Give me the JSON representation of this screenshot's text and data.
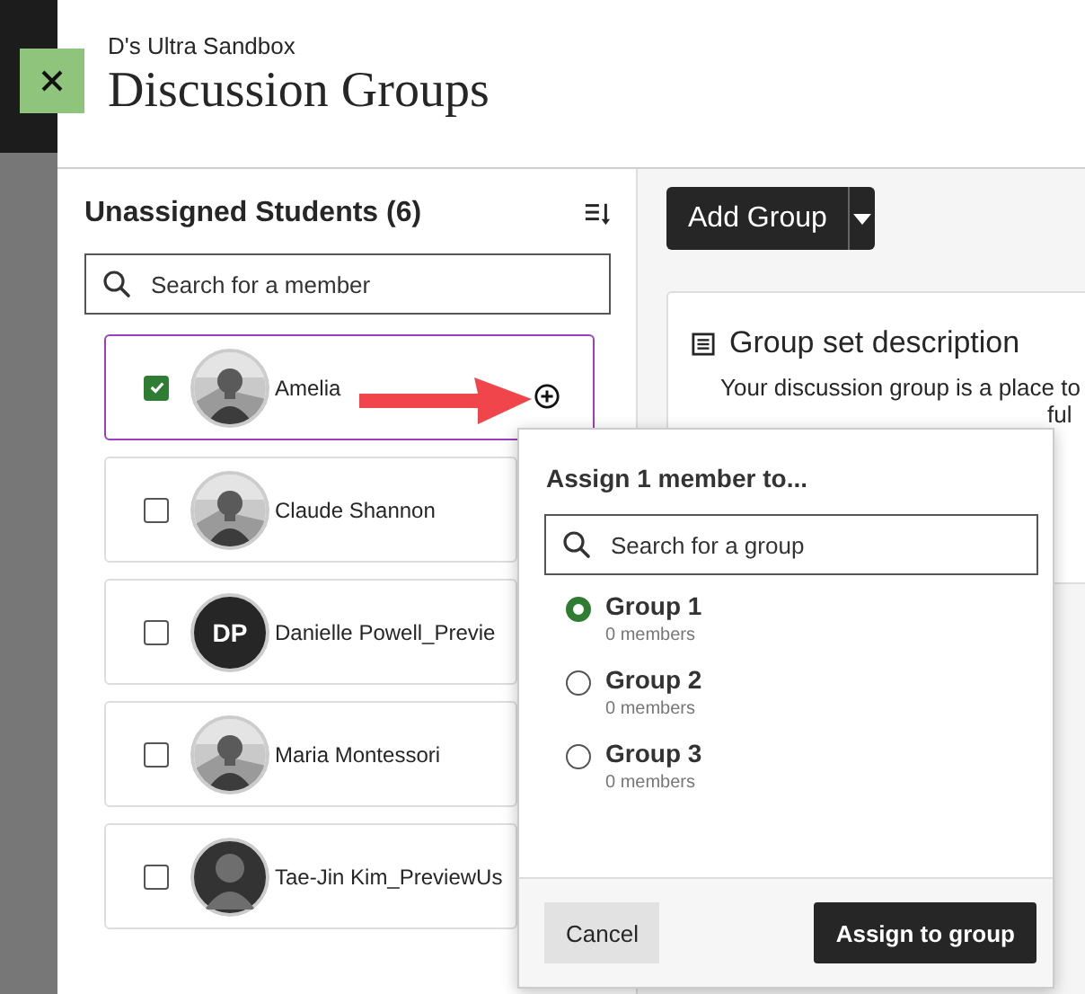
{
  "header": {
    "course": "D's Ultra Sandbox",
    "title": "Discussion Groups"
  },
  "unassigned": {
    "title": "Unassigned Students (6)",
    "search": {
      "placeholder": "Search for a member"
    },
    "students": [
      {
        "name": "Amelia",
        "checked": true
      },
      {
        "name": "Claude Shannon",
        "checked": false
      },
      {
        "name": "Danielle Powell_Previe",
        "checked": false,
        "avatar": {
          "kind": "initials",
          "initials": "DP"
        }
      },
      {
        "name": "Maria Montessori",
        "checked": false
      },
      {
        "name": "Tae-Jin Kim_PreviewUs",
        "checked": false,
        "avatar": {
          "kind": "silhouette"
        }
      }
    ]
  },
  "add_group": {
    "label": "Add Group"
  },
  "description_card": {
    "title": "Group set description",
    "lines": [
      "Your discussion group is a place to",
      "ful"
    ]
  },
  "assign_popup": {
    "title": "Assign 1 member to...",
    "search": {
      "placeholder": "Search for a group"
    },
    "groups": [
      {
        "name": "Group 1",
        "count": "0 members",
        "selected": true
      },
      {
        "name": "Group 2",
        "count": "0 members",
        "selected": false
      },
      {
        "name": "Group 3",
        "count": "0 members",
        "selected": false
      }
    ],
    "cancel": "Cancel",
    "assign": "Assign to group"
  }
}
